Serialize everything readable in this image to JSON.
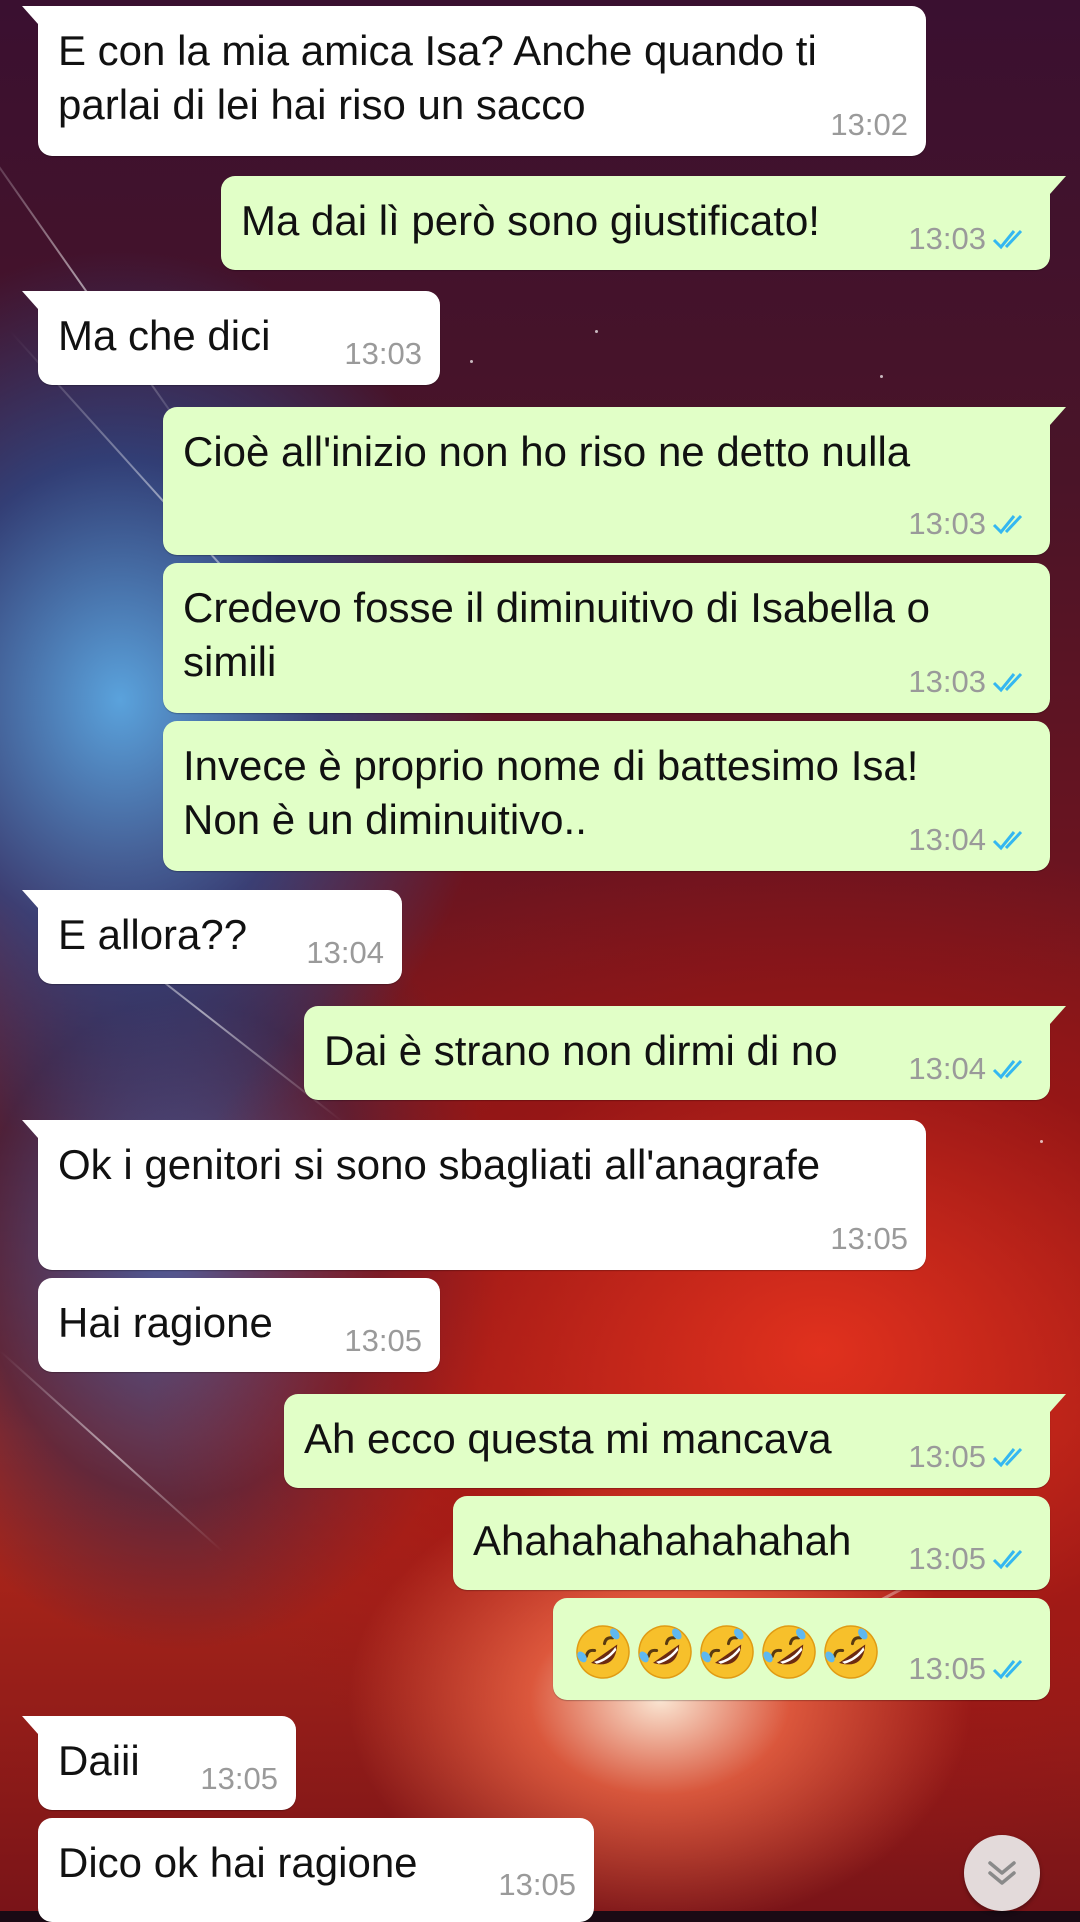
{
  "colors": {
    "incoming_bubble": "#ffffff",
    "outgoing_bubble": "#e1ffc7",
    "timestamp": "#9a9a9a",
    "read_ticks": "#34b7f1"
  },
  "messages": [
    {
      "direction": "in",
      "text": "E con la mia amica Isa? Anche quando ti\nparlai di lei hai riso un sacco",
      "time": "13:02"
    },
    {
      "direction": "out",
      "text": "Ma dai lì però sono giustificato!",
      "time": "13:03",
      "status": "read"
    },
    {
      "direction": "in",
      "text": "Ma che dici",
      "time": "13:03"
    },
    {
      "direction": "out",
      "text": "Cioè all'inizio non ho riso ne detto nulla",
      "time": "13:03",
      "status": "read"
    },
    {
      "direction": "out",
      "text": "Credevo fosse il diminuitivo di Isabella o\nsimili",
      "time": "13:03",
      "status": "read"
    },
    {
      "direction": "out",
      "text": "Invece è proprio nome di battesimo Isa!\nNon è un diminuitivo..",
      "time": "13:04",
      "status": "read"
    },
    {
      "direction": "in",
      "text": "E allora??",
      "time": "13:04"
    },
    {
      "direction": "out",
      "text": "Dai è strano non dirmi di no",
      "time": "13:04",
      "status": "read"
    },
    {
      "direction": "in",
      "text": "Ok i genitori si sono sbagliati all'anagrafe",
      "time": "13:05"
    },
    {
      "direction": "in",
      "text": "Hai ragione",
      "time": "13:05"
    },
    {
      "direction": "out",
      "text": "Ah ecco questa mi mancava",
      "time": "13:05",
      "status": "read"
    },
    {
      "direction": "out",
      "text": "Ahahahahahahahah",
      "time": "13:05",
      "status": "read"
    },
    {
      "direction": "out",
      "text": "🤣🤣🤣🤣🤣",
      "time": "13:05",
      "status": "read",
      "emoji": "rolling-on-floor-laughing",
      "emoji_count": 5
    },
    {
      "direction": "in",
      "text": "Daiii",
      "time": "13:05"
    },
    {
      "direction": "in",
      "text": "Dico ok hai ragione",
      "time": "13:05"
    }
  ],
  "scroll_button": {
    "icon": "double-chevron-down-icon"
  }
}
